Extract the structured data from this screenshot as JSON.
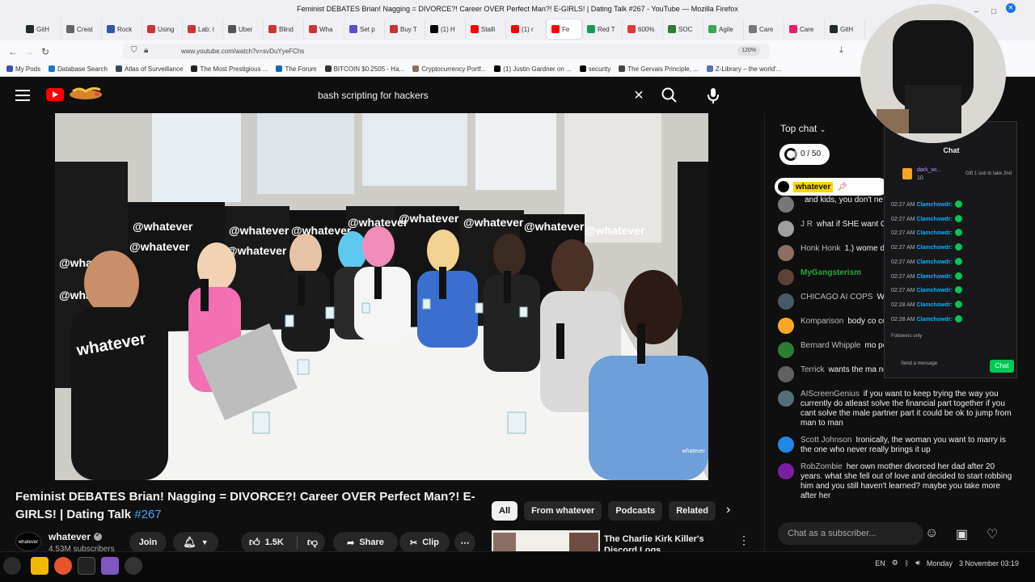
{
  "window": {
    "title": "Feminist DEBATES Brian! Nagging = DIVORCE?! Career OVER Perfect Man?! E-GIRLS! | Dating Talk #267 - YouTube — Mozilla Firefox"
  },
  "tabs": [
    {
      "label": "GitH",
      "color": "#24292e"
    },
    {
      "label": "Creat",
      "color": "#666666"
    },
    {
      "label": "Rock",
      "color": "#3355aa"
    },
    {
      "label": "Using",
      "color": "#cc3333"
    },
    {
      "label": "Lab: I",
      "color": "#cc3333"
    },
    {
      "label": "Uber",
      "color": "#555555"
    },
    {
      "label": "Blind",
      "color": "#cc3333"
    },
    {
      "label": "Wha",
      "color": "#cc3333"
    },
    {
      "label": "Set p",
      "color": "#5a4fcf"
    },
    {
      "label": "Buy T",
      "color": "#cc3333"
    },
    {
      "label": "(1) H",
      "color": "#000000"
    },
    {
      "label": "Stalli",
      "color": "#ff0000"
    },
    {
      "label": "(1) r",
      "color": "#ff0000"
    },
    {
      "label": "Fe",
      "color": "#ff0000",
      "active": true
    },
    {
      "label": "Red T",
      "color": "#0f9d58"
    },
    {
      "label": "600%",
      "color": "#e53935"
    },
    {
      "label": "SOC",
      "color": "#2e7d32"
    },
    {
      "label": "Agile",
      "color": "#3aa757"
    },
    {
      "label": "Care",
      "color": "#777777"
    },
    {
      "label": "Care",
      "color": "#e91e63"
    },
    {
      "label": "GitH",
      "color": "#24292e"
    }
  ],
  "nav": {
    "url": "www.youtube.com/watch?v=svDuYyeFChs",
    "zoom": "120%"
  },
  "bookmarks": [
    {
      "label": "My Pods",
      "color": "#3f51b5"
    },
    {
      "label": "Database Search",
      "color": "#1976d2"
    },
    {
      "label": "Atlas of Surveillance",
      "color": "#37474f"
    },
    {
      "label": "The Most Prestigious ...",
      "color": "#222222"
    },
    {
      "label": "The Forum",
      "color": "#1565c0"
    },
    {
      "label": "BITCOIN $0.2505 - Ha...",
      "color": "#333333"
    },
    {
      "label": "Cryptocurrency Portf...",
      "color": "#8d6e63"
    },
    {
      "label": "(1) Justin Gardner on ...",
      "color": "#000000"
    },
    {
      "label": "security",
      "color": "#000000"
    },
    {
      "label": "The Gervais Principle, ...",
      "color": "#444444"
    },
    {
      "label": "Z-Library – the world'...",
      "color": "#5c6bc0"
    }
  ],
  "search": {
    "query": "bash scripting for hackers"
  },
  "video": {
    "title": "Feminist DEBATES Brian! Nagging = DIVORCE?! Career OVER Perfect Man?! E-GIRLS! | Dating Talk",
    "tag": "#267",
    "watermark": "whatever",
    "overlay_texts": [
      "@whatever",
      "whatever"
    ],
    "channel": {
      "name": "whatever",
      "subscribers": "4.53M subscribers",
      "avatar_text": "whatever"
    },
    "actions": {
      "join": "Join",
      "likes": "1.5K",
      "share": "Share",
      "clip": "Clip"
    }
  },
  "chips": [
    "All",
    "From whatever",
    "Podcasts",
    "Related"
  ],
  "recommendation": {
    "title": "The Charlie Kirk Killer's Discord Logs"
  },
  "chat": {
    "mode": "Top chat",
    "points": "0 / 50",
    "pinned": "whatever",
    "messages": [
      {
        "author": "",
        "text": "and kids, you don't ne",
        "color": "#777777",
        "mod": false
      },
      {
        "author": "J R",
        "text": "what if SHE want GRILFRIENDS??",
        "color": "#9e9e9e",
        "mod": false
      },
      {
        "author": "Honk Honk",
        "text": "1.) wome doesn't need to be ma",
        "color": "#8d6e63",
        "mod": false
      },
      {
        "author": "MyGangsterism",
        "text": "",
        "color": "#5d4037",
        "mod": true
      },
      {
        "author": "CHICAGO AI COPS",
        "text": "W group",
        "color": "#455a64",
        "mod": false
      },
      {
        "author": "Komparison",
        "text": "body co comes to marriage",
        "color": "#f9a825",
        "mod": false
      },
      {
        "author": "Bernard Whipple",
        "text": "mo person going to leave",
        "color": "#2e7d32",
        "mod": false
      },
      {
        "author": "Terrick",
        "text": "wants the ma not to be a wife? lawd.",
        "color": "#616161",
        "mod": false
      },
      {
        "author": "AIScreenGenius",
        "text": "if you want to keep trying the way you currently do atleast solve the financial part together if you cant solve the male partner part it could be ok to jump from man to man",
        "color": "#546e7a",
        "mod": false
      },
      {
        "author": "Scott Johnson",
        "text": "Ironically, the woman you want to marry is the one who never really brings it up",
        "color": "#1e88e5",
        "mod": false
      },
      {
        "author": "RobZombie",
        "text": "her own mother divorced her dad after 20 years. what she fell out of love and decided to start robbing him and you still haven't learned? maybe you take more after her",
        "color": "#7b1fa2",
        "mod": false
      }
    ],
    "input_placeholder": "Chat as a subscriber..."
  },
  "overlay": {
    "title": "Chat",
    "gift_user": "dark_wi...",
    "gift_count": "10",
    "gift_text": "Gift 1 sub to take 2nd",
    "rows": [
      {
        "time": "02:27 AM",
        "user": "Clamchowdr:"
      },
      {
        "time": "02:27 AM",
        "user": "Clamchowdr:"
      },
      {
        "time": "02:27 AM",
        "user": "Clamchowdr:"
      },
      {
        "time": "02:27 AM",
        "user": "Clamchowdr:"
      },
      {
        "time": "02:27 AM",
        "user": "Clamchowdr:"
      },
      {
        "time": "02:27 AM",
        "user": "Clamchowdr:"
      },
      {
        "time": "02:27 AM",
        "user": "Clamchowdr:"
      },
      {
        "time": "02:28 AM",
        "user": "Clamchowdr:"
      },
      {
        "time": "02:28 AM",
        "user": "Clamchowdr:"
      }
    ],
    "followers_only": "Followers only",
    "send_placeholder": "Send a message",
    "chat_button": "Chat"
  },
  "taskbar": {
    "lang": "EN",
    "date": "Monday",
    "datetime": "3 November 03:19"
  }
}
